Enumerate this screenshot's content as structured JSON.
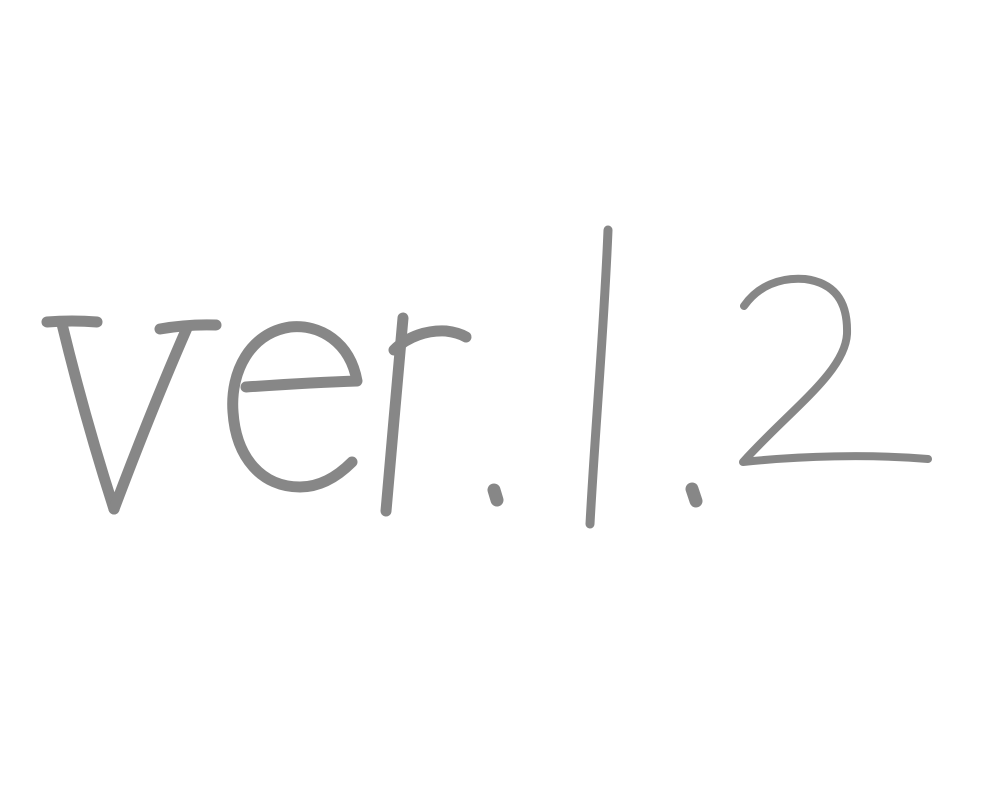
{
  "handwritten_text": "ver.1.2",
  "ink_color": "#878787",
  "background_color": "#ffffff"
}
